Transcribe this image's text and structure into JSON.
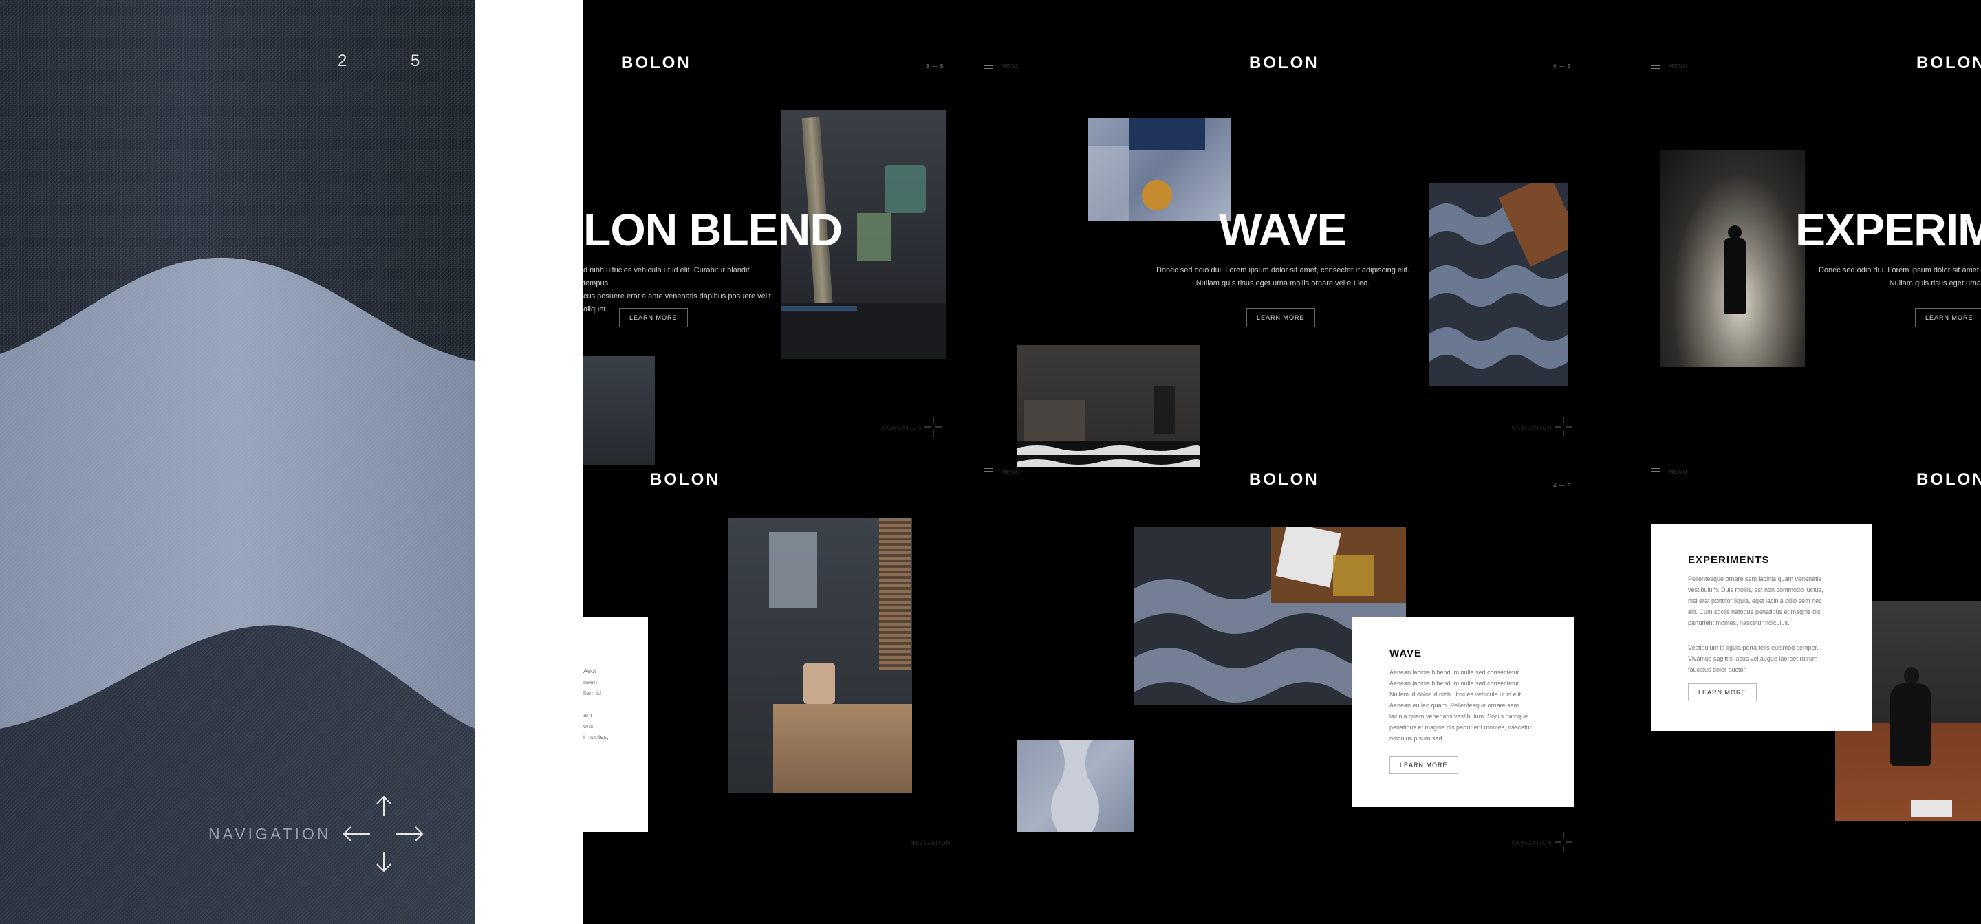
{
  "hero": {
    "pager_current": "2",
    "pager_total": "5",
    "navigation_label": "NAVIGATION"
  },
  "brand": {
    "logo": "BOLON"
  },
  "slides": {
    "blend": {
      "headline": "LON BLEND",
      "body_line1": "d nibh ultricies vehicula ut id elit. Curabitur blandit tempus",
      "body_line2": "cus posuere erat a ante venenatis dapibus posuere velit aliquet.",
      "button": "LEARN MORE",
      "pager": "3 — 5",
      "nav": "NAVIGATION"
    },
    "wave": {
      "menu": "MENU",
      "headline": "WAVE",
      "body_line1": "Donec sed odio dui. Lorem ipsum dolor sit amet, consectetur adipiscing elit.",
      "body_line2": "Nullam quis risus eget urna mollis ornare vel eu leo.",
      "button": "LEARN MORE",
      "pager": "4 — 5",
      "nav": "NAVIGATION"
    },
    "experiments": {
      "menu": "MENU",
      "headline": "EXPERIM",
      "body_line1": "Donec sed odio dui. Lorem ipsum dolor sit amet,",
      "body_line2": "Nullam quis risus eget urna",
      "button": "LEARN MORE"
    }
  },
  "details": {
    "blend": {
      "card_lines": [
        "Aeqt",
        "neen",
        "llam id",
        "",
        "am",
        "ons",
        "i montes,"
      ],
      "nav": "NAVIGATION"
    },
    "wave": {
      "menu": "MENU",
      "pager": "4 — 5",
      "card_title": "WAVE",
      "card_lines": [
        "Aenean lacinia bibendum nulla sed consectetur.",
        "Aenean lacinia bibendum nulla sed consectetur.",
        "Nullam id dolor id nibh ultricies vehicula ut id elit.",
        "Aenean eu leo quam. Pellentesque ornare sem",
        "lacinia quam venenatis vestibulum. Sociis natoque",
        "penatibus et magnis dis parturient montes, nascetur",
        "ridiculus pisum sed."
      ],
      "button": "LEARN MORE",
      "nav": "NAVIGATION"
    },
    "experiments": {
      "menu": "MENU",
      "card_title": "EXPERIMENTS",
      "card_lines": [
        "Pellentesque ornare sem lacinia quam venenatis",
        "vestibulum. Duis mollis, est non commodo luctus,",
        "nisi erat porttitor ligula, eget lacinia odio sem nec",
        "elit. Cum sociis natoque penatibus et magnis dis",
        "parturient montes, nascetur ridiculus."
      ],
      "card_lines2": [
        "Vestibulum id ligula porta felis euismod semper.",
        "Vivamus sagittis lacus vel augue laoreet rutrum",
        "faucibus dolor auctor."
      ],
      "button": "LEARN MORE"
    }
  },
  "colors": {
    "background": "#000000",
    "gutter": "#ffffff",
    "denim_light": "#8a97ae",
    "denim_dark": "#1f2630"
  }
}
